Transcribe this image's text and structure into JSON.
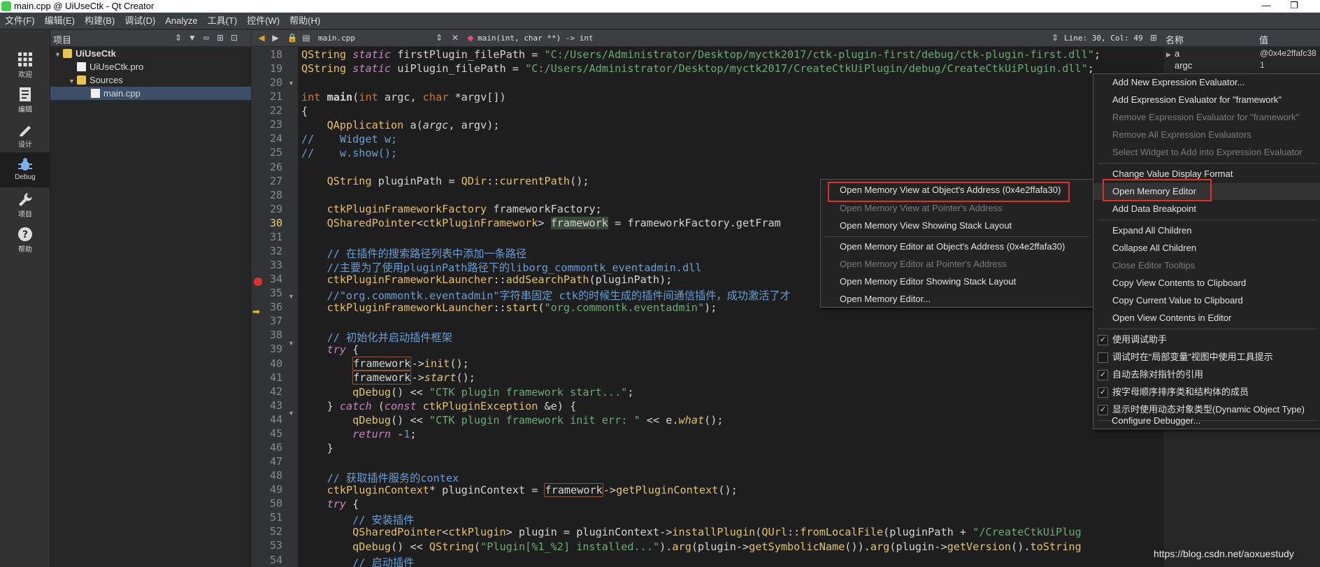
{
  "window": {
    "title": "main.cpp @ UiUseCtk - Qt Creator",
    "minimize": "—",
    "restore": "❐"
  },
  "menubar": [
    "文件(F)",
    "编辑(E)",
    "构建(B)",
    "调试(D)",
    "Analyze",
    "工具(T)",
    "控件(W)",
    "帮助(H)"
  ],
  "modes": [
    {
      "label": "欢迎",
      "icon": "grid-icon"
    },
    {
      "label": "编辑",
      "icon": "edit-icon"
    },
    {
      "label": "设计",
      "icon": "pen-icon"
    },
    {
      "label": "Debug",
      "icon": "bug-icon"
    },
    {
      "label": "项目",
      "icon": "wrench-icon"
    },
    {
      "label": "帮助",
      "icon": "help-icon"
    }
  ],
  "projects": {
    "title": "项目",
    "tree": [
      {
        "label": "UiUseCtk",
        "bold": true
      },
      {
        "label": "UiUseCtk.pro"
      },
      {
        "label": "Sources"
      },
      {
        "label": "main.cpp"
      }
    ]
  },
  "editor": {
    "file": "main.cpp",
    "function": "main(int, char **) -> int",
    "position": "Line: 30, Col: 49",
    "lines": [
      18,
      19,
      20,
      21,
      22,
      23,
      24,
      25,
      26,
      27,
      28,
      29,
      30,
      31,
      32,
      33,
      34,
      35,
      36,
      37,
      38,
      39,
      40,
      41,
      42,
      43,
      44,
      45,
      46,
      47,
      48,
      49,
      50,
      51,
      52,
      53,
      54
    ],
    "current_line": 30,
    "breakpoint_line": 34,
    "exec_line": 36
  },
  "locals": {
    "col_name": "名称",
    "col_value": "值",
    "rows": [
      {
        "name": "a",
        "value": "@0x4e2ffafc38"
      },
      {
        "name": "argc",
        "value": "1"
      }
    ]
  },
  "left_menu": {
    "items": [
      {
        "label": "Open Memory View at Object's Address (0x4e2ffafa30)",
        "disabled": false
      },
      {
        "label": "Open Memory View at Pointer's Address",
        "disabled": true
      },
      {
        "label": "Open Memory View Showing Stack Layout",
        "disabled": false
      },
      {
        "label": "Open Memory Editor at Object's Address (0x4e2ffafa30)",
        "disabled": false
      },
      {
        "label": "Open Memory Editor at Pointer's Address",
        "disabled": true
      },
      {
        "label": "Open Memory Editor Showing Stack Layout",
        "disabled": false
      },
      {
        "label": "Open Memory Editor...",
        "disabled": false
      }
    ]
  },
  "right_menu": {
    "items": [
      {
        "label": "Add New Expression Evaluator...",
        "disabled": false
      },
      {
        "label": "Add Expression Evaluator for \"framework\"",
        "disabled": false
      },
      {
        "label": "Remove Expression Evaluator for \"framework\"",
        "disabled": true
      },
      {
        "label": "Remove All Expression Evaluators",
        "disabled": true
      },
      {
        "label": "Select Widget to Add into Expression Evaluator",
        "disabled": true
      },
      {
        "label": "Change Value Display Format",
        "disabled": false
      },
      {
        "label": "Open Memory Editor",
        "disabled": false
      },
      {
        "label": "Add Data Breakpoint",
        "disabled": false
      },
      {
        "label": "Expand All Children",
        "disabled": false
      },
      {
        "label": "Collapse All Children",
        "disabled": false
      },
      {
        "label": "Close Editor Tooltips",
        "disabled": true
      },
      {
        "label": "Copy View Contents to Clipboard",
        "disabled": false
      },
      {
        "label": "Copy Current Value to Clipboard",
        "disabled": false
      },
      {
        "label": "Open View Contents in Editor",
        "disabled": false
      },
      {
        "label": "使用调试助手",
        "checked": true
      },
      {
        "label": "调试时在“局部变量”视图中使用工具提示",
        "checked": false
      },
      {
        "label": "自动去除对指针的引用",
        "checked": true
      },
      {
        "label": "按字母顺序排序类和结构体的成员",
        "checked": true
      },
      {
        "label": "显示时使用动态对象类型(Dynamic Object Type)",
        "checked": true
      },
      {
        "label": "Configure Debugger...",
        "disabled": false
      }
    ]
  },
  "watermark": "https://blog.csdn.net/aoxuestudy"
}
